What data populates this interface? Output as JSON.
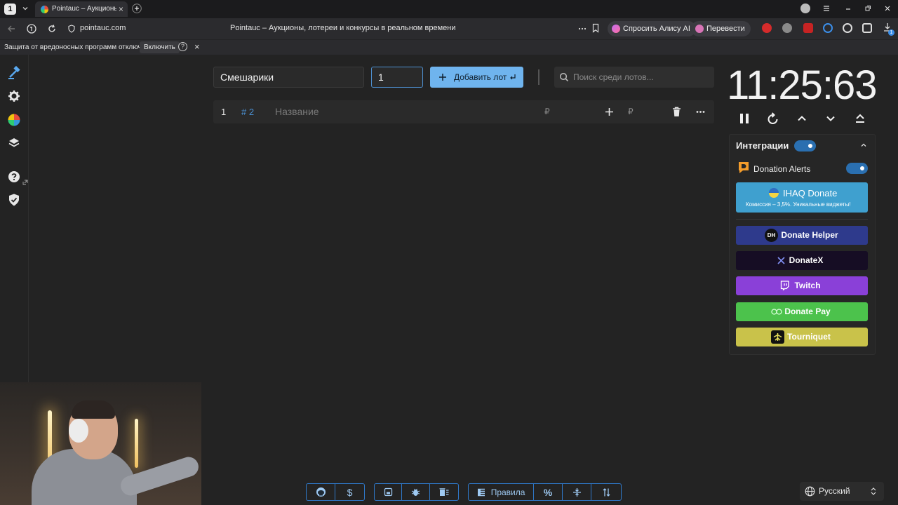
{
  "browser": {
    "tab_counter": "1",
    "tab_title": "Pointauc – Аукционы,",
    "url": "pointauc.com",
    "page_title": "Pointauc – Аукционы, лотереи и конкурсы в реальном времени",
    "ask_alice": "Спросить Алису AI",
    "translate": "Перевести",
    "security_warning": "Защита от вредоносных программ отключена",
    "enable": "Включить",
    "help": "?",
    "close": "×",
    "ext_badge": "1"
  },
  "toolbar": {
    "lot_name_value": "Смешарики",
    "amount_value": "1",
    "add_lot_label": "Добавить лот",
    "search_placeholder": "Поиск среди лотов..."
  },
  "lots": [
    {
      "index": "1",
      "number": "# 2",
      "name_placeholder": "Название",
      "currency": "₽",
      "add_currency": "₽"
    }
  ],
  "timer": {
    "value": "11:25:63"
  },
  "integrations": {
    "title": "Интеграции",
    "donation_alerts": "Donation Alerts",
    "ihaq_title": "IHAQ Donate",
    "ihaq_subtitle": "Комиссия – 3,5%. Уникальные виджеты!",
    "donate_helper": "Donate Helper",
    "donatex": "DonateX",
    "twitch": "Twitch",
    "donate_pay": "Donate Pay",
    "tourniquet": "Tourniquet"
  },
  "bottom": {
    "rules_label": "Правила"
  },
  "language": {
    "value": "Русский"
  },
  "colors": {
    "accent": "#6fb4ee",
    "toggle": "#2a6fb0",
    "ihaq": "#3fa0cf",
    "donate_helper": "#2e3a8c",
    "donatex": "#160d24",
    "twitch": "#8a40d8",
    "donate_pay": "#4cc24c",
    "tourniquet": "#c9c24a"
  }
}
